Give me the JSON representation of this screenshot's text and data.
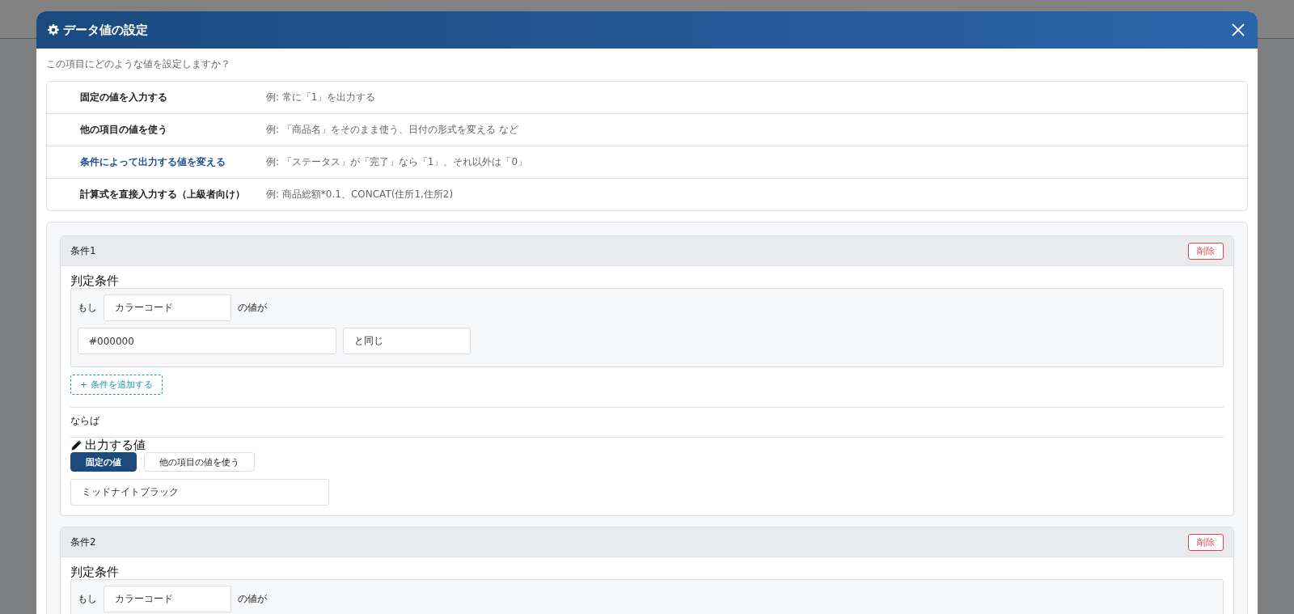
{
  "dialog": {
    "title": "データ値の設定",
    "prompt": "この項目にどのような値を設定しますか？",
    "modes": [
      {
        "label": "固定の値を入力する",
        "example": "例: 常に「1」を出力する",
        "selected": false
      },
      {
        "label": "他の項目の値を使う",
        "example": "例: 「商品名」をそのまま使う、日付の形式を変える など",
        "selected": false
      },
      {
        "label": "条件によって出力する値を変える",
        "example": "例: 「ステータス」が「完了」なら「1」、それ以外は「0」",
        "selected": true
      },
      {
        "label": "計算式を直接入力する（上級者向け）",
        "example": "例: 商品総額*0.1、CONCAT(住所1,住所2)",
        "selected": false
      }
    ],
    "conditions": [
      {
        "title": "条件1",
        "delete_label": "削除",
        "heading": "判定条件",
        "if_label": "もし",
        "field": "カラーコード",
        "field_suffix": "の値が",
        "compare_value": "#000000",
        "operator": "と同じ",
        "add_label": "+ 条件を追加する",
        "then_label": "ならば",
        "output_heading": "出力する値",
        "output_tabs": [
          {
            "label": "固定の値",
            "selected": true
          },
          {
            "label": "他の項目の値を使う",
            "selected": false
          }
        ],
        "output_value": "ミッドナイトブラック"
      },
      {
        "title": "条件2",
        "delete_label": "削除",
        "heading": "判定条件",
        "if_label": "もし",
        "field": "カラーコード",
        "field_suffix": "の値が"
      }
    ]
  }
}
